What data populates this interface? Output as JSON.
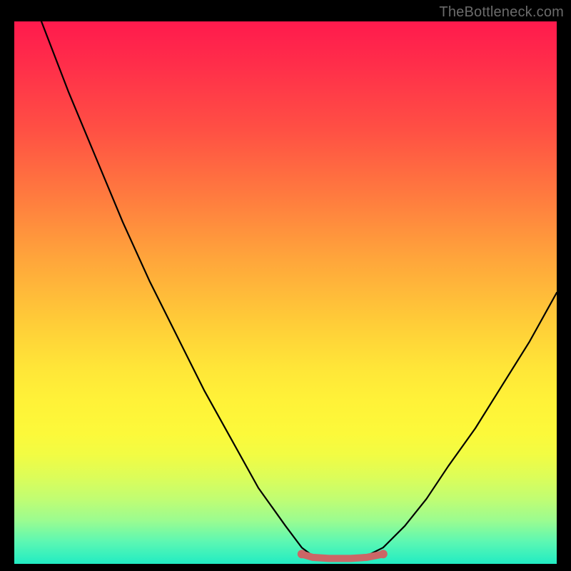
{
  "watermark": "TheBottleneck.com",
  "chart_data": {
    "type": "line",
    "title": "",
    "xlabel": "",
    "ylabel": "",
    "xlim": [
      0,
      100
    ],
    "ylim": [
      0,
      100
    ],
    "series": [
      {
        "name": "curve",
        "color": "#000000",
        "points": [
          {
            "x": 5,
            "y": 100
          },
          {
            "x": 10,
            "y": 87
          },
          {
            "x": 15,
            "y": 75
          },
          {
            "x": 20,
            "y": 63
          },
          {
            "x": 25,
            "y": 52
          },
          {
            "x": 30,
            "y": 42
          },
          {
            "x": 35,
            "y": 32
          },
          {
            "x": 40,
            "y": 23
          },
          {
            "x": 45,
            "y": 14
          },
          {
            "x": 50,
            "y": 7
          },
          {
            "x": 53,
            "y": 3
          },
          {
            "x": 55,
            "y": 1.5
          },
          {
            "x": 58,
            "y": 1
          },
          {
            "x": 62,
            "y": 1
          },
          {
            "x": 65,
            "y": 1.5
          },
          {
            "x": 68,
            "y": 3
          },
          {
            "x": 72,
            "y": 7
          },
          {
            "x": 76,
            "y": 12
          },
          {
            "x": 80,
            "y": 18
          },
          {
            "x": 85,
            "y": 25
          },
          {
            "x": 90,
            "y": 33
          },
          {
            "x": 95,
            "y": 41
          },
          {
            "x": 100,
            "y": 50
          }
        ]
      },
      {
        "name": "flat-segment",
        "color": "#cc6666",
        "points": [
          {
            "x": 53,
            "y": 1.8
          },
          {
            "x": 55,
            "y": 1.2
          },
          {
            "x": 58,
            "y": 1.0
          },
          {
            "x": 60,
            "y": 1.0
          },
          {
            "x": 62,
            "y": 1.0
          },
          {
            "x": 65,
            "y": 1.2
          },
          {
            "x": 68,
            "y": 1.8
          }
        ]
      }
    ],
    "gradient_stops": [
      {
        "pos": 0,
        "color": "#ff1a4d"
      },
      {
        "pos": 50,
        "color": "#ffcc38"
      },
      {
        "pos": 80,
        "color": "#f5fc40"
      },
      {
        "pos": 100,
        "color": "#21ecc3"
      }
    ]
  }
}
